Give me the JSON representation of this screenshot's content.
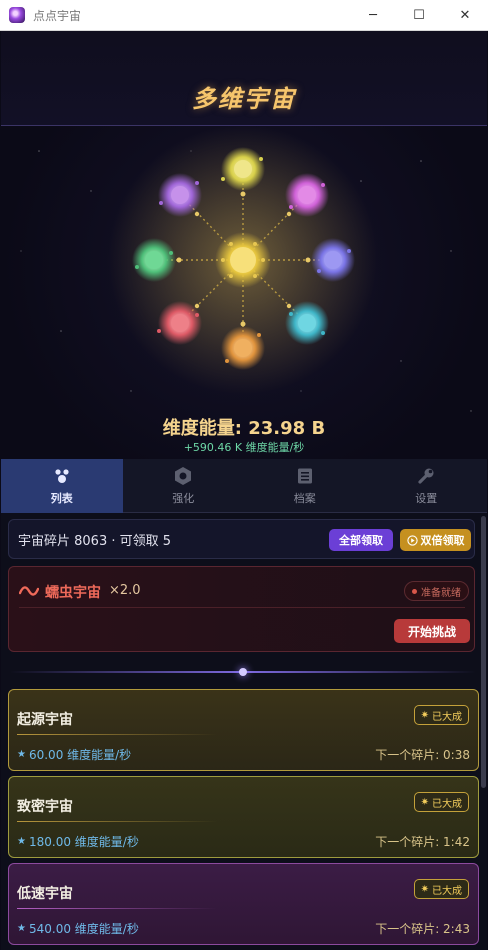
{
  "window": {
    "title": "点点宇宙",
    "minimize": "─",
    "maximize": "☐",
    "close": "✕"
  },
  "hero": {
    "title": "多维宇宙",
    "energy_label": "维度能量: 23.98 B",
    "energy_rate": "+590.46 K 维度能量/秒"
  },
  "tabs": [
    {
      "label": "列表",
      "icon": "orbit-icon",
      "active": true
    },
    {
      "label": "强化",
      "icon": "hex-gear-icon",
      "active": false
    },
    {
      "label": "档案",
      "icon": "archive-icon",
      "active": false
    },
    {
      "label": "设置",
      "icon": "wrench-icon",
      "active": false
    }
  ],
  "shards": {
    "text": "宇宙碎片 8063 · 可领取 5",
    "claim_all": "全部领取",
    "claim_double": "双倍领取"
  },
  "boss": {
    "name": "蠕虫宇宙",
    "multiplier": "×2.0",
    "status": "准备就绪",
    "challenge": "开始挑战"
  },
  "universes": [
    {
      "name": "起源宇宙",
      "badge": "已大成",
      "rate": "60.00 维度能量/秒",
      "next": "下一个碎片: 0:38"
    },
    {
      "name": "致密宇宙",
      "badge": "已大成",
      "rate": "180.00 维度能量/秒",
      "next": "下一个碎片: 1:42"
    },
    {
      "name": "低速宇宙",
      "badge": "已大成",
      "rate": "540.00 维度能量/秒",
      "next": "下一个碎片: 2:43"
    }
  ],
  "colors": {
    "accent_gold": "#f6c56c",
    "tab_active": "#2a3a72",
    "claim_all": "#6b3fd6",
    "claim_double": "#c59020",
    "challenge": "#b83a3a",
    "rate_text": "#6dd6a6"
  }
}
